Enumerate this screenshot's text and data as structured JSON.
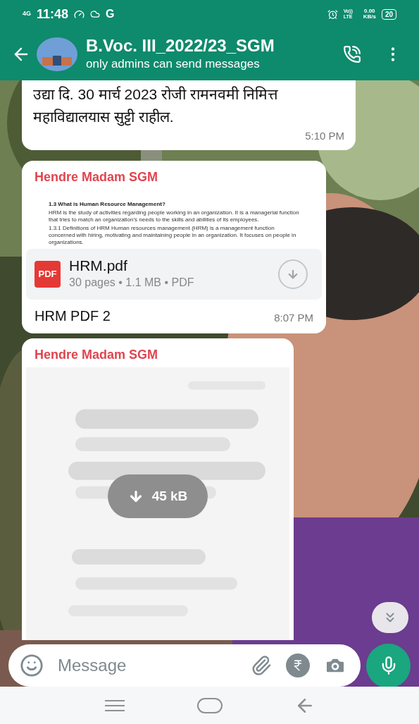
{
  "status_bar": {
    "network": "4G",
    "time": "11:48",
    "carrier_letter": "G",
    "volte": "Vo)) LTE",
    "speed": "0.00",
    "speed_unit": "KB/s",
    "battery": "20"
  },
  "header": {
    "title": "B.Voc. III_2022/23_SGM",
    "subtitle": "only admins can send messages"
  },
  "messages": [
    {
      "kind": "text",
      "text": "उद्या दि. 30 मार्च 2023 रोजी रामनवमी निमित्त महाविद्यालयास सुट्टी राहील.",
      "time": "5:10 PM"
    },
    {
      "kind": "document",
      "sender": "Hendre Madam SGM",
      "preview_heading": "1.3 What is Human Resource Management?",
      "preview_lines": [
        "HRM is the study of activities regarding people working in an organization. It is a managerial function that tries to match an organization's needs to the skills and abilities of its employees.",
        "1.3.1 Definitions of HRM Human resources management (HRM) is a management function concerned with hiring, motivating and maintaining people in an organization. It focuses on people in organizations."
      ],
      "file_name": "HRM.pdf",
      "file_badge": "PDF",
      "file_meta": "30 pages • 1.1 MB • PDF",
      "caption": "HRM PDF 2",
      "time": "8:07 PM"
    },
    {
      "sender": "Hendre Madam SGM",
      "download_size": "45 kB"
    }
  ],
  "composer": {
    "placeholder": "Message"
  }
}
